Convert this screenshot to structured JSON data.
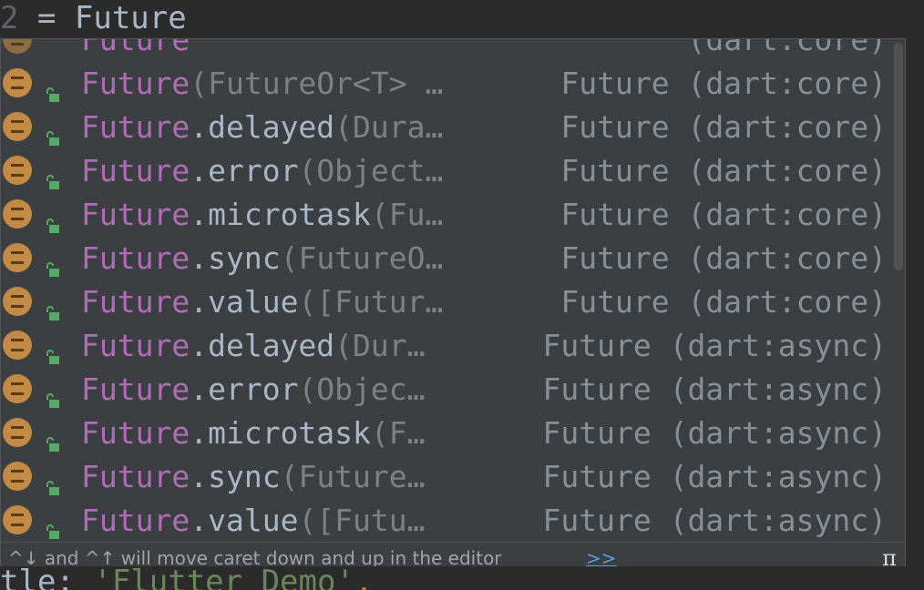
{
  "editor": {
    "top_line": {
      "gutter_num": "2",
      "text": " = Future"
    },
    "bottom_line": {
      "ident": "tle: ",
      "string": "'Flutter Demo'",
      "trailing": ","
    }
  },
  "popup": {
    "partial_row": {
      "name": "Future",
      "type": "(dart:core)"
    },
    "items": [
      {
        "cls": "Future",
        "dot": "",
        "member": "",
        "params": "(FutureOr<T> …",
        "type": "Future (dart:core)"
      },
      {
        "cls": "Future",
        "dot": ".",
        "member": "delayed",
        "params": "(Dura…",
        "type": "Future (dart:core)"
      },
      {
        "cls": "Future",
        "dot": ".",
        "member": "error",
        "params": "(Object…",
        "type": "Future (dart:core)"
      },
      {
        "cls": "Future",
        "dot": ".",
        "member": "microtask",
        "params": "(Fu…",
        "type": "Future (dart:core)"
      },
      {
        "cls": "Future",
        "dot": ".",
        "member": "sync",
        "params": "(FutureO…",
        "type": "Future (dart:core)"
      },
      {
        "cls": "Future",
        "dot": ".",
        "member": "value",
        "params": "([Futur…",
        "type": "Future (dart:core)"
      },
      {
        "cls": "Future",
        "dot": ".",
        "member": "delayed",
        "params": "(Dur…",
        "type": "Future (dart:async)"
      },
      {
        "cls": "Future",
        "dot": ".",
        "member": "error",
        "params": "(Objec…",
        "type": "Future (dart:async)"
      },
      {
        "cls": "Future",
        "dot": ".",
        "member": "microtask",
        "params": "(F…",
        "type": "Future (dart:async)"
      },
      {
        "cls": "Future",
        "dot": ".",
        "member": "sync",
        "params": "(Future…",
        "type": "Future (dart:async)"
      },
      {
        "cls": "Future",
        "dot": ".",
        "member": "value",
        "params": "([Futu…",
        "type": "Future (dart:async)"
      }
    ],
    "footer": {
      "hint": "^↓ and ^↑ will move caret down and up in the editor",
      "more_link": ">>",
      "pi_label": "π"
    }
  }
}
